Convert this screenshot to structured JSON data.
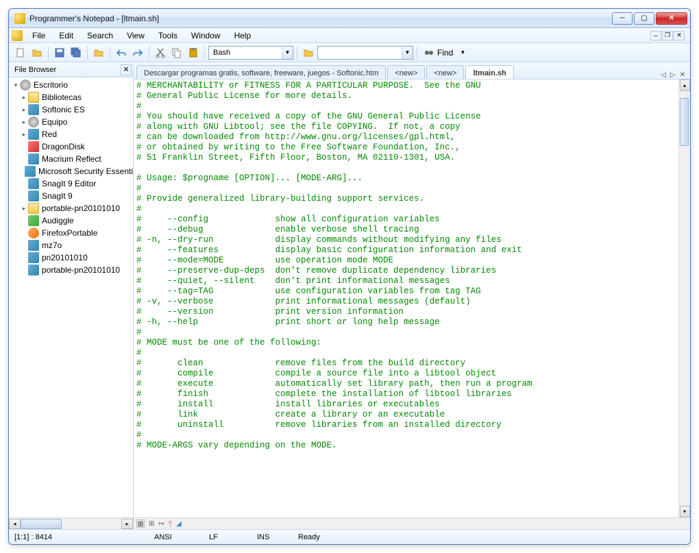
{
  "window": {
    "title": "Programmer's Notepad - [ltmain.sh]"
  },
  "menu": {
    "file": "File",
    "edit": "Edit",
    "search": "Search",
    "view": "View",
    "tools": "Tools",
    "window": "Window",
    "help": "Help"
  },
  "toolbar": {
    "lang": "Bash",
    "find": "Find"
  },
  "sidebar": {
    "title": "File Browser",
    "root": "Escritorio",
    "items": [
      {
        "label": "Bibliotecas",
        "expandable": true,
        "icon": "folder"
      },
      {
        "label": "Softonic ES",
        "expandable": true,
        "icon": "app"
      },
      {
        "label": "Equipo",
        "expandable": true,
        "icon": "disk"
      },
      {
        "label": "Red",
        "expandable": true,
        "icon": "app"
      },
      {
        "label": "DragonDisk",
        "expandable": false,
        "icon": "red"
      },
      {
        "label": "Macrium Reflect",
        "expandable": false,
        "icon": "app"
      },
      {
        "label": "Microsoft Security Essenti",
        "expandable": false,
        "icon": "app"
      },
      {
        "label": "SnagIt 9 Editor",
        "expandable": false,
        "icon": "app"
      },
      {
        "label": "SnagIt 9",
        "expandable": false,
        "icon": "app"
      },
      {
        "label": "portable-pn20101010",
        "expandable": true,
        "icon": "folder"
      },
      {
        "label": "Audiggle",
        "expandable": false,
        "icon": "green"
      },
      {
        "label": "FirefoxPortable",
        "expandable": false,
        "icon": "orange"
      },
      {
        "label": "mz7o",
        "expandable": false,
        "icon": "app"
      },
      {
        "label": "pn20101010",
        "expandable": false,
        "icon": "app"
      },
      {
        "label": "portable-pn20101010",
        "expandable": false,
        "icon": "app"
      }
    ]
  },
  "tabs": [
    {
      "label": "Descargar programas gratis, software, freeware, juegos - Softonic.htm",
      "active": false
    },
    {
      "label": "<new>",
      "active": false
    },
    {
      "label": "<new>",
      "active": false
    },
    {
      "label": "ltmain.sh",
      "active": true
    }
  ],
  "editor_lines": [
    "# MERCHANTABILITY or FITNESS FOR A PARTICULAR PURPOSE.  See the GNU",
    "# General Public License for more details.",
    "#",
    "# You should have received a copy of the GNU General Public License",
    "# along with GNU Libtool; see the file COPYING.  If not, a copy",
    "# can be downloaded from http://www.gnu.org/licenses/gpl.html,",
    "# or obtained by writing to the Free Software Foundation, Inc.,",
    "# 51 Franklin Street, Fifth Floor, Boston, MA 02110-1301, USA.",
    "",
    "# Usage: $progname [OPTION]... [MODE-ARG]...",
    "#",
    "# Provide generalized library-building support services.",
    "#",
    "#     --config             show all configuration variables",
    "#     --debug              enable verbose shell tracing",
    "# -n, --dry-run            display commands without modifying any files",
    "#     --features           display basic configuration information and exit",
    "#     --mode=MODE          use operation mode MODE",
    "#     --preserve-dup-deps  don't remove duplicate dependency libraries",
    "#     --quiet, --silent    don't print informational messages",
    "#     --tag=TAG            use configuration variables from tag TAG",
    "# -v, --verbose            print informational messages (default)",
    "#     --version            print version information",
    "# -h, --help               print short or long help message",
    "#",
    "# MODE must be one of the following:",
    "#",
    "#       clean              remove files from the build directory",
    "#       compile            compile a source file into a libtool object",
    "#       execute            automatically set library path, then run a program",
    "#       finish             complete the installation of libtool libraries",
    "#       install            install libraries or executables",
    "#       link               create a library or an executable",
    "#       uninstall          remove libraries from an installed directory",
    "#",
    "# MODE-ARGS vary depending on the MODE."
  ],
  "status": {
    "pos": "[1:1] : 8414",
    "enc": "ANSI",
    "le": "LF",
    "ins": "INS",
    "ready": "Ready"
  }
}
